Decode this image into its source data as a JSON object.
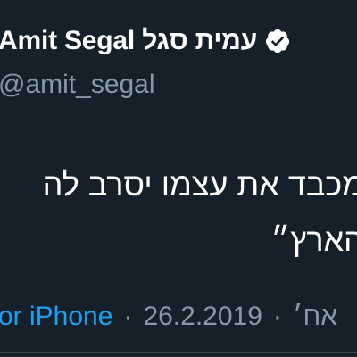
{
  "author": {
    "display_name": "Amit Segal עמית סגל",
    "handle": "@amit_segal",
    "verified": true
  },
  "tweet": {
    "lines": [
      "מכבד את עצמו יסרב לה",
      "הארץ״"
    ]
  },
  "meta": {
    "source": "or iPhone",
    "separator": "·",
    "date": "26.2.2019",
    "time_fragment": "אח׳"
  },
  "colors": {
    "background": "#15202b",
    "text": "#ffffff",
    "secondary": "#8899a6",
    "link": "#1da1f2"
  }
}
